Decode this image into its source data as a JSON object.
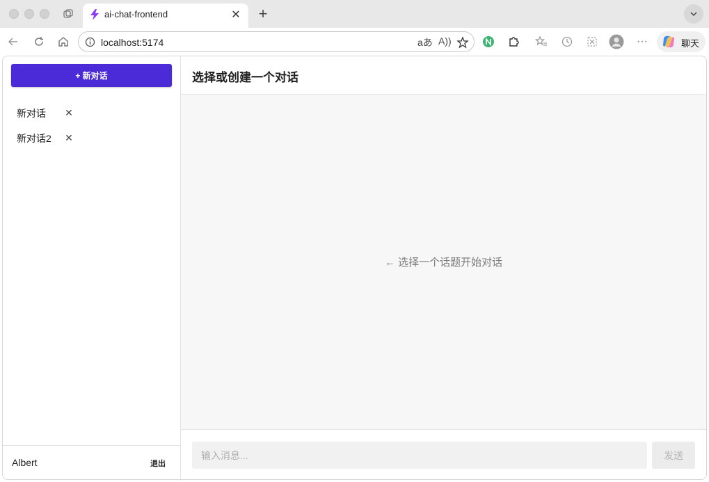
{
  "browser": {
    "tab": {
      "title": "ai-chat-frontend",
      "favicon": "vite-bolt-icon"
    },
    "address": {
      "url": "localhost:5174"
    },
    "chat_button_label": "聊天"
  },
  "app": {
    "sidebar": {
      "new_chat_label": "+ 新对话",
      "conversations": [
        {
          "title": "新对话"
        },
        {
          "title": "新对话2"
        }
      ],
      "user_name": "Albert",
      "logout_label": "退出"
    },
    "main": {
      "title": "选择或创建一个对话",
      "empty_hint": "← 选择一个话题开始对话",
      "input_placeholder": "输入消息...",
      "send_label": "发送"
    }
  },
  "colors": {
    "accent": "#4b2ad8",
    "content_bg": "#f7f7f7"
  }
}
